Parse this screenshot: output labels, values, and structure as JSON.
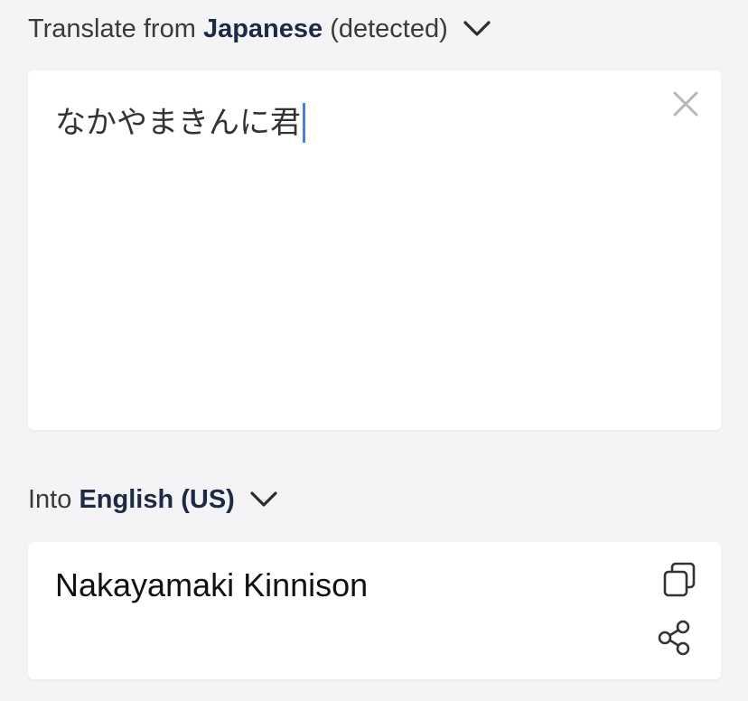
{
  "source_language": {
    "prefix": "Translate from",
    "language": "Japanese",
    "suffix": "(detected)",
    "dropdown_icon": "chevron-down-icon"
  },
  "source_input": {
    "value": "なかやまきんに君",
    "clear_icon": "close-icon"
  },
  "target_language": {
    "prefix": "Into",
    "language": "English (US)",
    "dropdown_icon": "chevron-down-icon"
  },
  "translation": {
    "text": "Nakayamaki Kinnison",
    "copy_icon": "copy-icon",
    "share_icon": "share-icon"
  },
  "colors": {
    "background": "#f4f4f6",
    "card": "#ffffff",
    "language_emphasis": "#1e2a44",
    "caret": "#4a7fe0",
    "icon": "#333333",
    "clear_icon": "#b8b8bc"
  }
}
